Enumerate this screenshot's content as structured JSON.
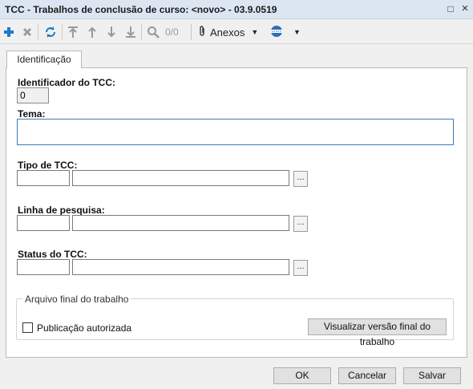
{
  "window": {
    "title": "TCC - Trabalhos de conclusão de curso: <novo> - 03.9.0519",
    "minimize_icon": "□",
    "close_icon": "×"
  },
  "toolbar": {
    "record_counter": "0/0",
    "anexos_label": "Anexos",
    "icons": [
      "add-icon",
      "delete-icon",
      "refresh-icon",
      "first-icon",
      "previous-icon",
      "next-icon",
      "last-icon",
      "search-icon",
      "paperclip-icon",
      "globe-icon"
    ]
  },
  "tabs": {
    "identificacao": "Identificação"
  },
  "form": {
    "identificador_label": "Identificador do TCC:",
    "identificador_value": "0",
    "tema_label": "Tema:",
    "tema_value": "",
    "tipo_label": "Tipo de TCC:",
    "tipo_code": "",
    "tipo_desc": "",
    "linha_label": "Linha de pesquisa:",
    "linha_code": "",
    "linha_desc": "",
    "status_label": "Status do TCC:",
    "status_code": "",
    "status_desc": "",
    "ellipsis": "..."
  },
  "arquivo": {
    "legend": "Arquivo final do trabalho",
    "checkbox_label": "Publicação autorizada",
    "checkbox_checked": false,
    "view_button": "Visualizar versão final do trabalho"
  },
  "footer": {
    "ok": "OK",
    "cancel": "Cancelar",
    "save": "Salvar"
  },
  "colors": {
    "add": "#1f7ac9",
    "titlebar": "#dce6f2",
    "tema_border": "#3d7ab8"
  }
}
